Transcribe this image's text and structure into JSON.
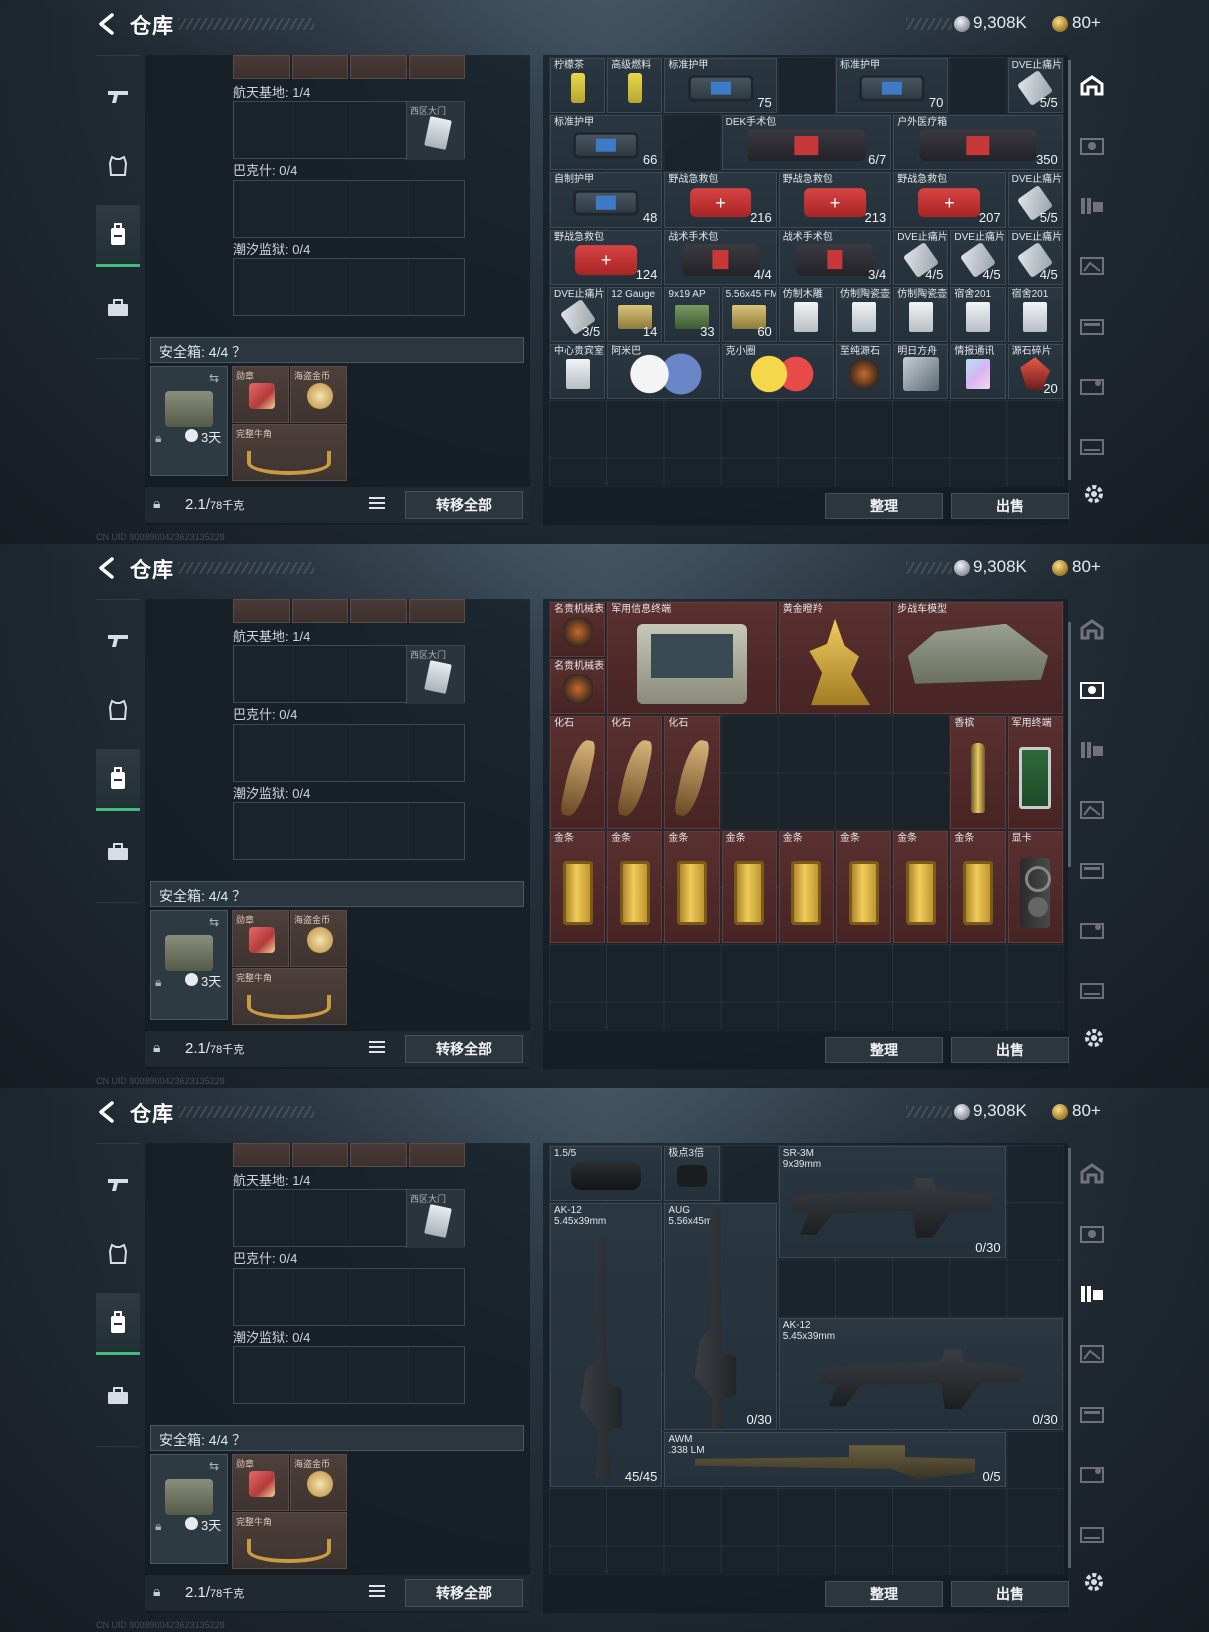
{
  "header": {
    "title": "仓库",
    "currency_silver": "9,308K",
    "currency_gold": "80+"
  },
  "left": {
    "maps": [
      {
        "label": "航天基地: 1/4",
        "key_label": "西区大门"
      },
      {
        "label": "巴克什: 0/4",
        "key_label": ""
      },
      {
        "label": "潮汐监狱: 0/4",
        "key_label": ""
      }
    ],
    "safe": {
      "label": "安全箱: 4/4 ？",
      "days": "3天",
      "items": [
        {
          "label": "勋章"
        },
        {
          "label": "海盗金币"
        },
        {
          "label": "完整牛角"
        }
      ]
    },
    "weight_value": "2.1/",
    "weight_unit": "78千克",
    "transfer_label": "转移全部"
  },
  "right_footer": {
    "sort_label": "整理",
    "sell_label": "出售"
  },
  "screen1_items": [
    {
      "label": "柠檬茶",
      "value": ""
    },
    {
      "label": "高级燃料",
      "value": ""
    },
    {
      "label": "标准护甲",
      "value": "75"
    },
    {
      "label": "标准护甲",
      "value": "70"
    },
    {
      "label": "DVE止痛片",
      "value": "5/5"
    },
    {
      "label": "标准护甲",
      "value": "66"
    },
    {
      "label": "DEK手术包",
      "value": "6/7"
    },
    {
      "label": "户外医疗箱",
      "value": "350"
    },
    {
      "label": "自制护甲",
      "value": "48"
    },
    {
      "label": "野战急救包",
      "value": "216"
    },
    {
      "label": "野战急救包",
      "value": "213"
    },
    {
      "label": "野战急救包",
      "value": "207"
    },
    {
      "label": "DVE止痛片",
      "value": "5/5"
    },
    {
      "label": "野战急救包",
      "value": "124"
    },
    {
      "label": "战术手术包",
      "value": "4/4"
    },
    {
      "label": "战术手术包",
      "value": "3/4"
    },
    {
      "label": "DVE止痛片",
      "value": "4/5"
    },
    {
      "label": "DVE止痛片",
      "value": "4/5"
    },
    {
      "label": "DVE止痛片",
      "value": "4/5"
    },
    {
      "label": "DVE止痛片",
      "value": "3/5"
    },
    {
      "label": "12 Gauge",
      "value": "14"
    },
    {
      "label": "9x19 AP",
      "value": "33"
    },
    {
      "label": "5.56x45 FMJ",
      "value": "60"
    },
    {
      "label": "仿制木雕",
      "value": ""
    },
    {
      "label": "仿制陶瓷壶",
      "value": ""
    },
    {
      "label": "仿制陶瓷壶",
      "value": ""
    },
    {
      "label": "宿舍201",
      "value": ""
    },
    {
      "label": "宿舍201",
      "value": ""
    },
    {
      "label": "中心贵宾室",
      "value": ""
    },
    {
      "label": "阿米巴",
      "value": ""
    },
    {
      "label": "克小圈",
      "value": ""
    },
    {
      "label": "至纯源石",
      "value": ""
    },
    {
      "label": "明日方舟",
      "value": ""
    },
    {
      "label": "情报通讯",
      "value": ""
    },
    {
      "label": "源石碎片",
      "value": "20"
    }
  ],
  "screen2_items": [
    {
      "label": "名贵机械表"
    },
    {
      "label": "军用信息终端"
    },
    {
      "label": "黄金瞪羚"
    },
    {
      "label": "步战车模型"
    },
    {
      "label": "名贵机械表"
    },
    {
      "label": "化石"
    },
    {
      "label": "化石"
    },
    {
      "label": "化石"
    },
    {
      "label": "香槟"
    },
    {
      "label": "军用终端"
    },
    {
      "label": "金条"
    },
    {
      "label": "金条"
    },
    {
      "label": "金条"
    },
    {
      "label": "金条"
    },
    {
      "label": "金条"
    },
    {
      "label": "金条"
    },
    {
      "label": "金条"
    },
    {
      "label": "金条"
    },
    {
      "label": "显卡"
    }
  ],
  "screen3_items": [
    {
      "label": "1.5/5",
      "value": ""
    },
    {
      "label": "极点3倍",
      "value": ""
    },
    {
      "label": "SR-3M\n9x39mm",
      "value": "0/30"
    },
    {
      "label": "AK-12\n5.45x39mm",
      "value": "45/45"
    },
    {
      "label": "AUG\n5.56x45mm",
      "value": "0/30"
    },
    {
      "label": "AK-12\n5.45x39mm",
      "value": "0/30"
    },
    {
      "label": "AWM\n.338 LM",
      "value": "0/5"
    }
  ],
  "status_text": "CN UID 9008900423623135229"
}
